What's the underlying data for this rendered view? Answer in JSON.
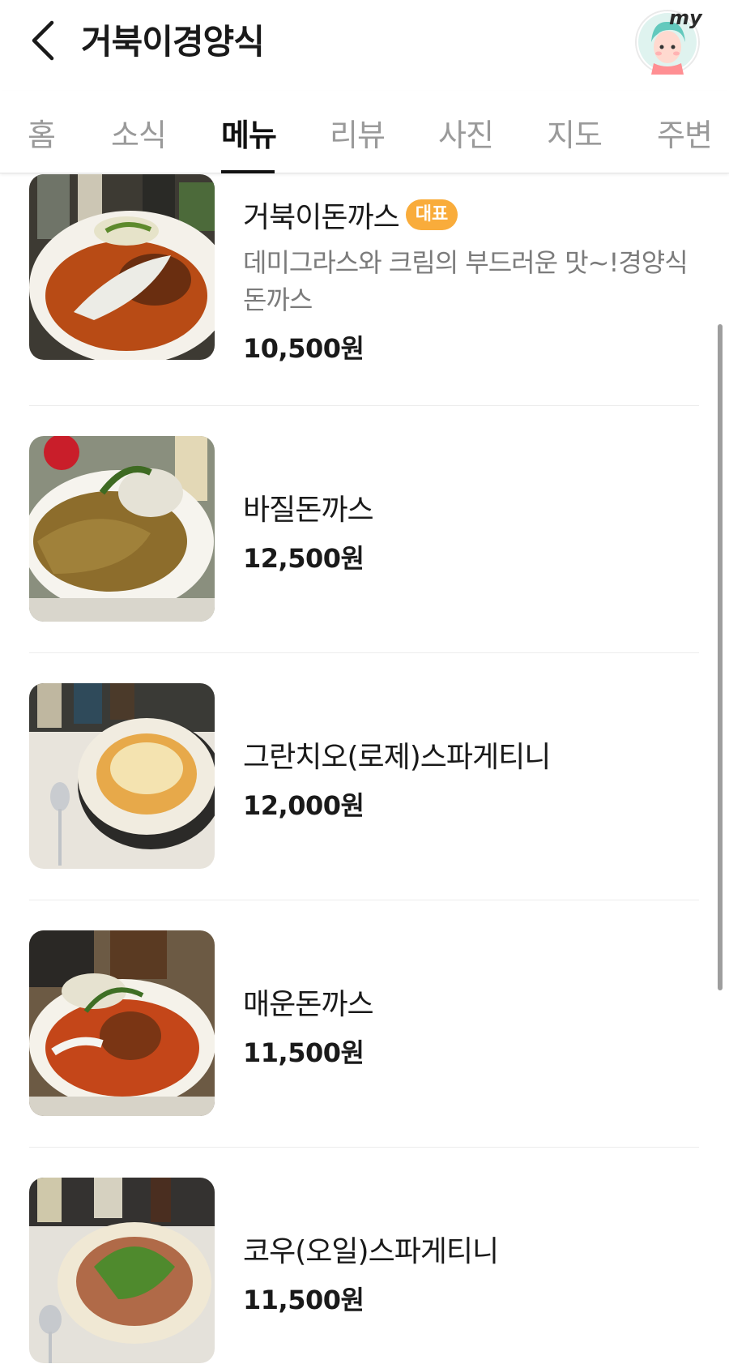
{
  "header": {
    "back_icon": "chevron-left-icon",
    "title": "거북이경양식",
    "avatar_label": "my"
  },
  "tabs": [
    {
      "label": "홈",
      "active": false
    },
    {
      "label": "소식",
      "active": false
    },
    {
      "label": "메뉴",
      "active": true
    },
    {
      "label": "리뷰",
      "active": false
    },
    {
      "label": "사진",
      "active": false
    },
    {
      "label": "지도",
      "active": false
    },
    {
      "label": "주변",
      "active": false
    }
  ],
  "menu": {
    "items": [
      {
        "name": "거북이돈까스",
        "badge": "대표",
        "desc": "데미그라스와 크림의 부드러운 맛~!경양식 돈까스",
        "price": "10,500원"
      },
      {
        "name": "바질돈까스",
        "price": "12,500원"
      },
      {
        "name": "그란치오(로제)스파게티니",
        "price": "12,000원"
      },
      {
        "name": "매운돈까스",
        "price": "11,500원"
      },
      {
        "name": "코우(오일)스파게티니",
        "price": "11,500원"
      }
    ]
  },
  "colors": {
    "accent_badge": "#f9ac3b",
    "active_tab": "#111111",
    "inactive_tab": "#9a9a9a"
  }
}
